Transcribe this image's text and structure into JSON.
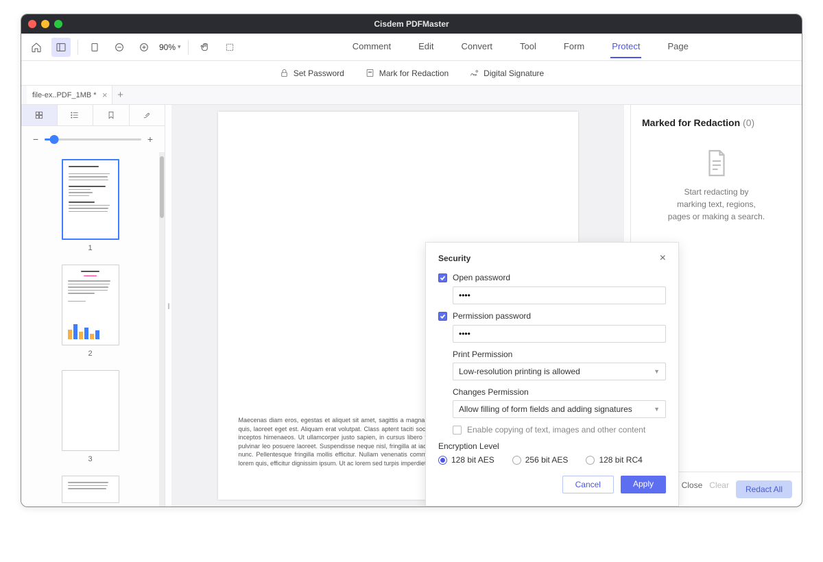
{
  "appTitle": "Cisdem PDFMaster",
  "zoom": "90%",
  "menu": {
    "items": [
      "Comment",
      "Edit",
      "Convert",
      "Tool",
      "Form",
      "Protect",
      "Page"
    ],
    "active": "Protect"
  },
  "subbar": {
    "setPassword": "Set Password",
    "markRedaction": "Mark for Redaction",
    "digitalSignature": "Digital Signature"
  },
  "tab": {
    "name": "file-ex..PDF_1MB *"
  },
  "thumbs": {
    "1": "1",
    "2": "2",
    "3": "3"
  },
  "docText": {
    "p1": "Maecenas diam eros, egestas et aliquet sit amet, sagittis a magna. Aliquam ante quam, pellentesque ut dignissim quis, laoreet eget est. Aliquam erat volutpat. Class aptent taciti sociosqu ad litora torquent per conubia nostra, per inceptos himenaeos. Ut ullamcorper justo sapien, in cursus libero viverra eget. Vivamus auctor imperdiet urna, at pulvinar leo posuere laoreet. Suspendisse neque nisl, fringilla at iaculis scelerisque, ornare vel dolor. Ut et pulvinar nunc. Pellentesque fringilla mollis efficitur. Nullam venenatis commodo imperdiet. Morbi velit neque, semper quis lorem quis, efficitur dignissim ipsum. Ut ac lorem sed turpis imperdiet eleifend sit amet id sapien."
  },
  "rightPanel": {
    "title": "Marked for Redaction",
    "count": "(0)",
    "hint1": "Start redacting by",
    "hint2": "marking text, regions,",
    "hint3": "pages or making a search.",
    "close": "Close",
    "clear": "Clear",
    "redactAll": "Redact All"
  },
  "modal": {
    "title": "Security",
    "openPassword": "Open password",
    "openPwVal": "••••",
    "permPassword": "Permission password",
    "permPwVal": "••••",
    "printPerm": "Print Permission",
    "printPermVal": "Low-resolution printing is allowed",
    "changesPerm": "Changes Permission",
    "changesPermVal": "Allow filling of form fields and adding signatures",
    "enableCopy": "Enable copying of text, images and other content",
    "encLevel": "Encryption Level",
    "enc128aes": "128 bit AES",
    "enc256aes": "256 bit AES",
    "enc128rc4": "128 bit RC4",
    "cancel": "Cancel",
    "apply": "Apply"
  }
}
